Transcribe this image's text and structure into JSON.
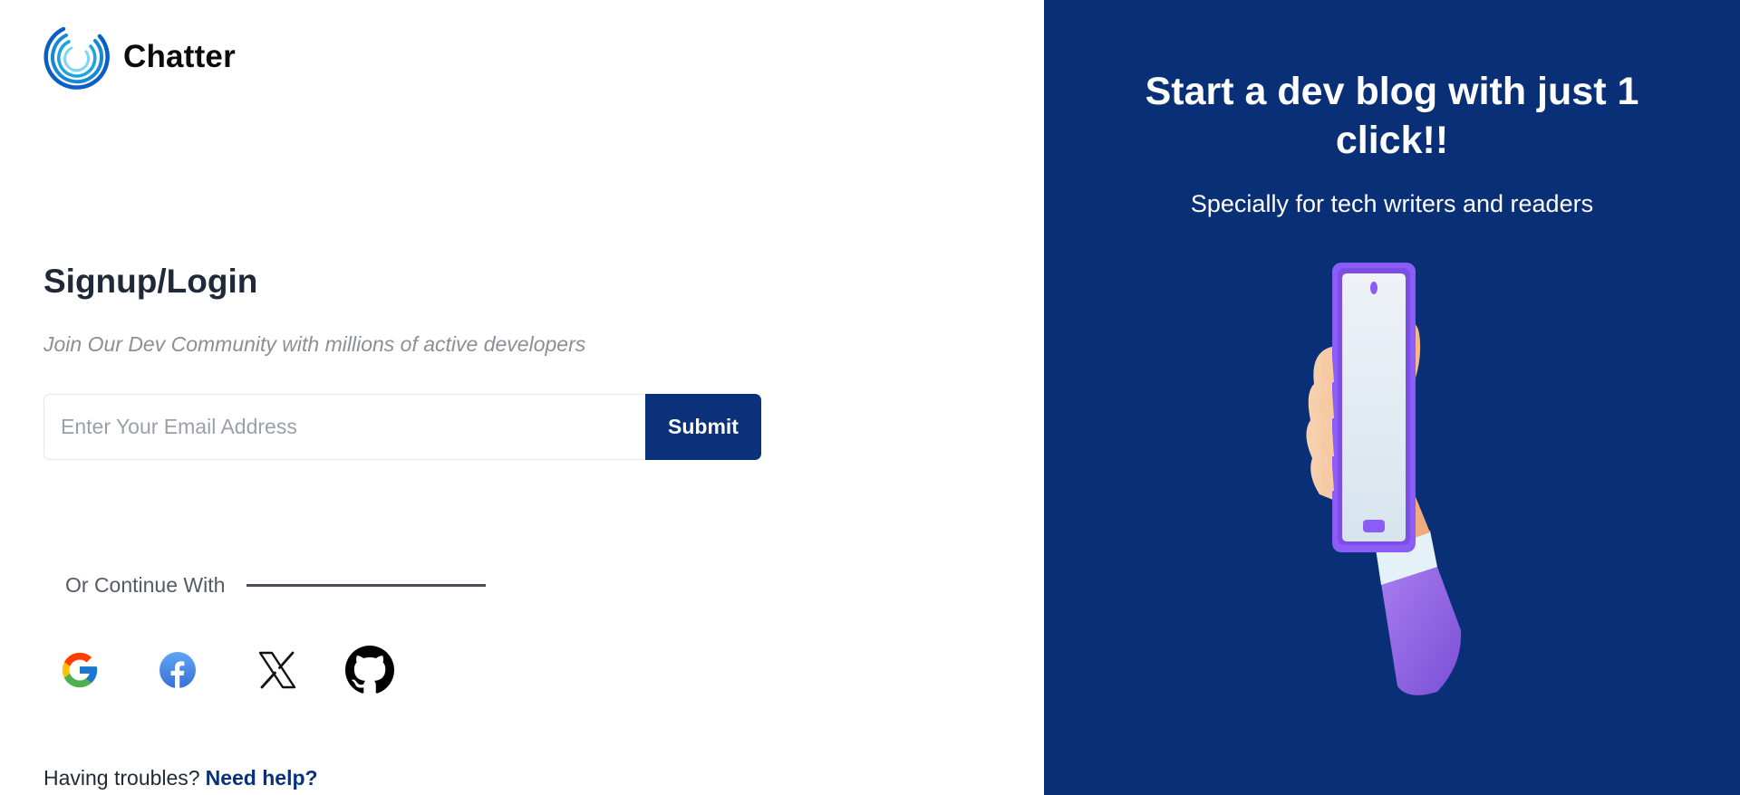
{
  "brand": {
    "name": "Chatter",
    "logo_icon": "chatter-logo-icon",
    "logo_colors": [
      "#0a5fc4",
      "#1fa3e0",
      "#7fd3f5"
    ]
  },
  "auth": {
    "title": "Signup/Login",
    "subtitle": "Join Our Dev Community with millions of active developers",
    "email_placeholder": "Enter Your Email Address",
    "email_value": "",
    "submit_label": "Submit"
  },
  "social": {
    "divider_label": "Or Continue With",
    "providers": [
      {
        "name": "Google",
        "icon": "google-icon"
      },
      {
        "name": "Facebook",
        "icon": "facebook-icon"
      },
      {
        "name": "X",
        "icon": "x-icon"
      },
      {
        "name": "GitHub",
        "icon": "github-icon"
      }
    ]
  },
  "help": {
    "prompt": "Having troubles?",
    "link_label": "Need help?"
  },
  "promo": {
    "title": "Start a dev blog with just 1 click!!",
    "subtitle": "Specially for tech writers and readers",
    "illustration": "hand-holding-phone-illustration"
  },
  "colors": {
    "accent": "#0a317a",
    "panel_background": "#092f77",
    "text_dark": "#1f2937",
    "text_muted": "#8b8f96"
  }
}
